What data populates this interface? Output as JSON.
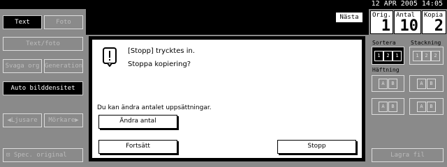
{
  "status_bar": {
    "datetime": "12 APR  2005 14:05"
  },
  "left_panel": {
    "text_label": "Text",
    "photo_label": "Foto",
    "text_photo_label": "Text/foto",
    "pale_original_label": "Svaga org",
    "generation_label": "Generation",
    "auto_density_label": "Auto bilddensitet",
    "lighter_label": "Ljusare",
    "darker_label": "Mörkare",
    "special_original_label": "Spec. original"
  },
  "header": {
    "next_label": "Nästa"
  },
  "counters": {
    "originals": {
      "label": "Orig.",
      "value": "1"
    },
    "quantity": {
      "label": "Antal",
      "value": "10"
    },
    "copies": {
      "label": "Kopia",
      "value": "2"
    }
  },
  "right_panel": {
    "sort_label": "Sortera",
    "stack_label": "Stackning",
    "staple_label": "Häftning",
    "save_label": "Lagra fil"
  },
  "dialog": {
    "line1": "[Stopp] trycktes in.",
    "line2": "Stoppa kopiering?",
    "info": "Du kan ändra antalet uppsättningar.",
    "change_qty_label": "Ändra antal",
    "continue_label": "Fortsätt",
    "stop_label": "Stopp"
  }
}
